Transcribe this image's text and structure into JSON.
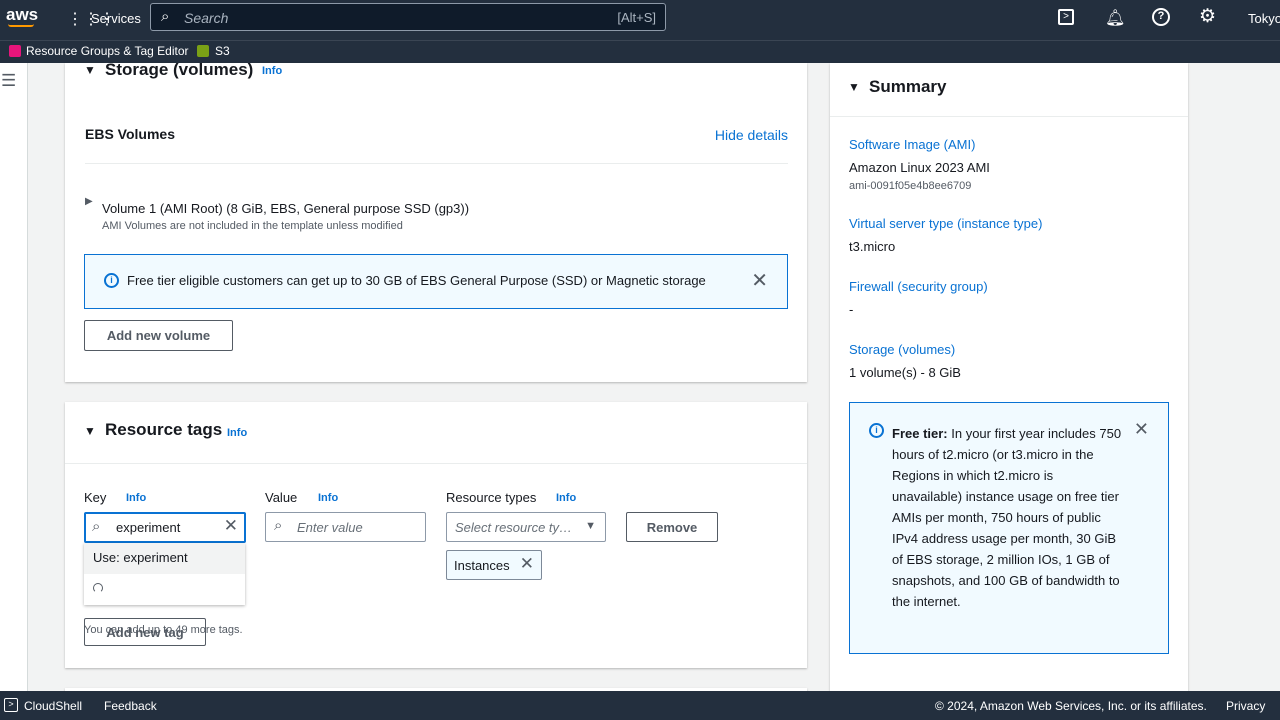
{
  "topbar": {
    "logo": "aws",
    "services": "Services",
    "search_placeholder": "Search",
    "shortcut": "[Alt+S]",
    "region": "Tokyo"
  },
  "favorites": [
    {
      "label": "Resource Groups & Tag Editor",
      "color": "#e7157b"
    },
    {
      "label": "S3",
      "color": "#7aa116"
    }
  ],
  "storage": {
    "title": "Storage (volumes)",
    "info": "Info",
    "ebs_title": "EBS Volumes",
    "hide_details": "Hide details",
    "volume": "Volume 1 (AMI Root) (8 GiB, EBS, General purpose SSD (gp3))",
    "volume_note": "AMI Volumes are not included in the template unless modified",
    "alert": "Free tier eligible customers can get up to 30 GB of EBS General Purpose (SSD) or Magnetic storage",
    "add_volume": "Add new volume"
  },
  "tags": {
    "title": "Resource tags",
    "info": "Info",
    "key_label": "Key",
    "value_label": "Value",
    "types_label": "Resource types",
    "key_value": "experiment",
    "value_placeholder": "Enter value",
    "types_placeholder": "Select resource ty…",
    "remove": "Remove",
    "token": "Instances",
    "suggestion": "Use: experiment",
    "add_tag": "Add new tag",
    "hint": "You can add up to 49 more tags."
  },
  "summary": {
    "title": "Summary",
    "ami_label": "Software Image (AMI)",
    "ami_value": "Amazon Linux 2023 AMI",
    "ami_id": "ami-0091f05e4b8ee6709",
    "type_label": "Virtual server type (instance type)",
    "type_value": "t3.micro",
    "fw_label": "Firewall (security group)",
    "fw_value": "-",
    "storage_label": "Storage (volumes)",
    "storage_value": "1 volume(s) - 8 GiB",
    "free_bold": "Free tier:",
    "free_text": " In your first year includes 750 hours of t2.micro (or t3.micro in the Regions in which t2.micro is unavailable) instance usage on free tier AMIs per month, 750 hours of public IPv4 address usage per month, 30 GiB of EBS storage, 2 million IOs, 1 GB of snapshots, and 100 GB of bandwidth to the internet."
  },
  "footer": {
    "cloudshell": "CloudShell",
    "feedback": "Feedback",
    "copyright": "© 2024, Amazon Web Services, Inc. or its affiliates.",
    "privacy": "Privacy"
  }
}
